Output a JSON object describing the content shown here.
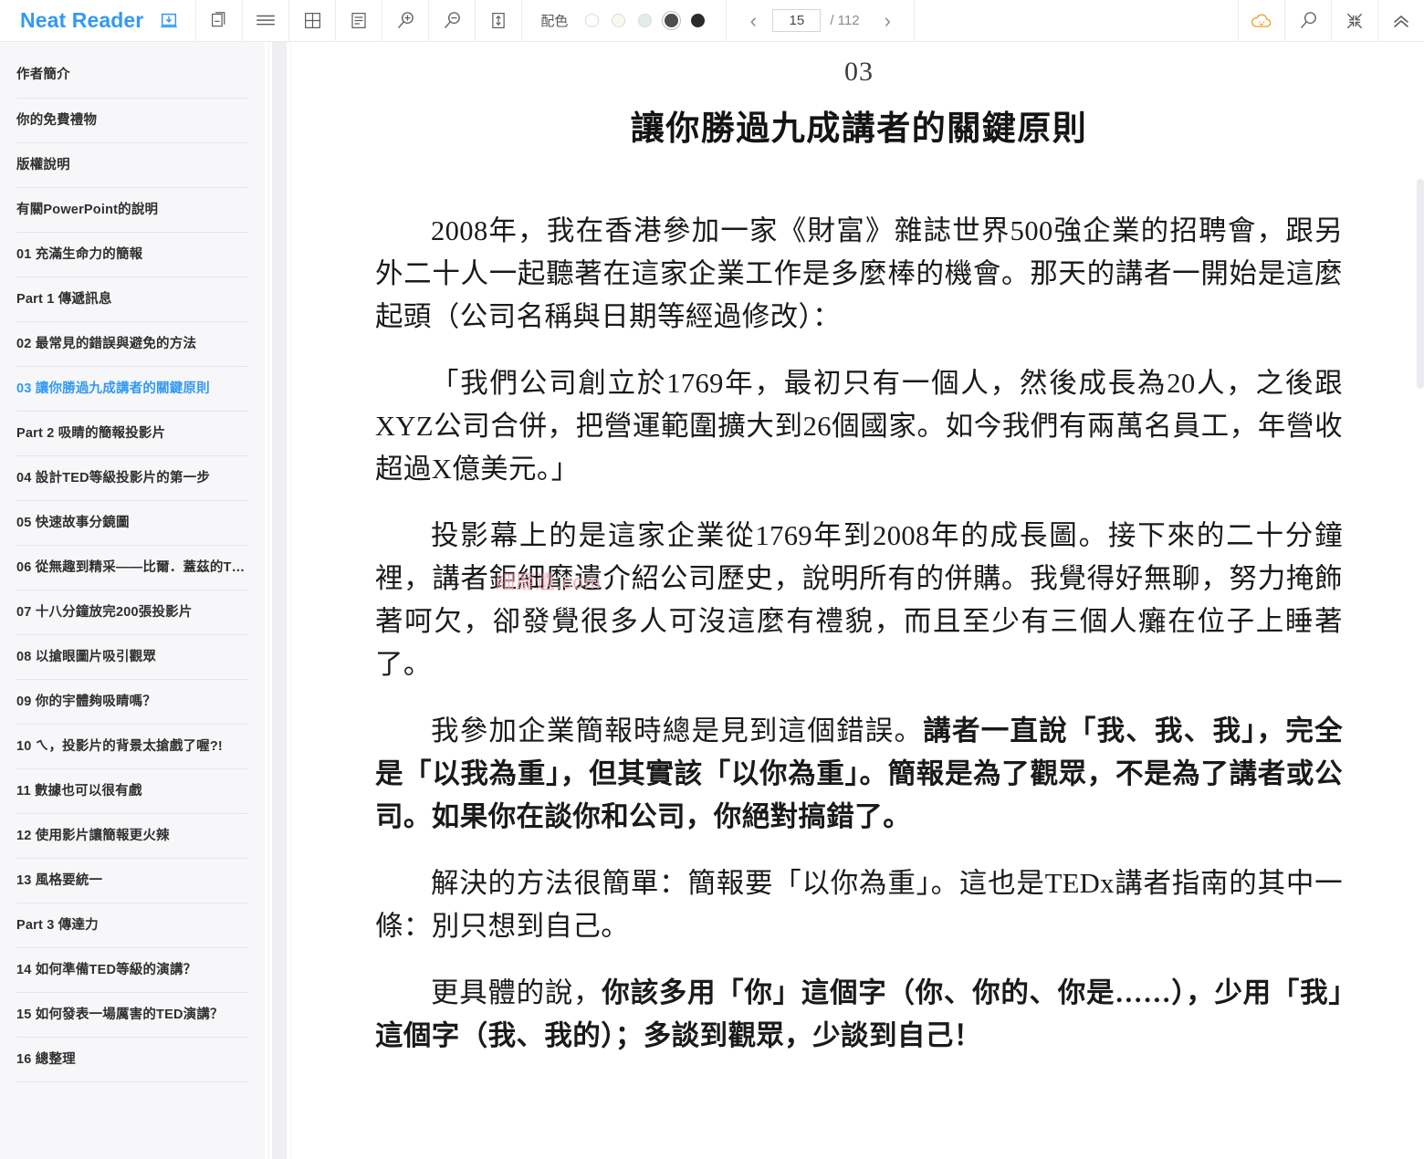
{
  "app": {
    "brand": "Neat Reader",
    "brand_color": "#3399f3"
  },
  "toolbar": {
    "icons": [
      {
        "name": "import-book-icon",
        "label": "匯入"
      },
      {
        "name": "two-page-layout-icon",
        "label": "雙頁"
      },
      {
        "name": "list-view-icon",
        "label": "列表"
      },
      {
        "name": "grid-view-icon",
        "label": "格狀"
      },
      {
        "name": "notes-icon",
        "label": "筆記"
      },
      {
        "name": "zoom-in-icon",
        "label": "放大"
      },
      {
        "name": "zoom-out-icon",
        "label": "縮小"
      },
      {
        "name": "line-height-icon",
        "label": "行距"
      }
    ],
    "palette_label": "配色",
    "swatches": [
      {
        "name": "theme-white",
        "color": "#ffffff",
        "selected": false
      },
      {
        "name": "theme-cream",
        "color": "#fbf8f1",
        "selected": false
      },
      {
        "name": "theme-green",
        "color": "#e2efe6",
        "selected": false
      },
      {
        "name": "theme-gray",
        "color": "#4d4d4d",
        "selected": true
      },
      {
        "name": "theme-black",
        "color": "#2b2b2b",
        "selected": false
      }
    ],
    "pager": {
      "prev": "‹",
      "next": "›",
      "current": "15",
      "separator": "/ 112",
      "total": "112"
    },
    "right_icons": [
      {
        "name": "cloud-sync-icon",
        "color": "#f0a028"
      },
      {
        "name": "search-icon",
        "color": "#6e6e6e"
      },
      {
        "name": "compress-icon",
        "color": "#6e6e6e"
      },
      {
        "name": "chevron-up-double-icon",
        "color": "#6e6e6e"
      }
    ]
  },
  "sidebar": {
    "items": [
      {
        "label": "作者簡介",
        "active": false
      },
      {
        "label": "你的免費禮物",
        "active": false
      },
      {
        "label": "版權說明",
        "active": false
      },
      {
        "label": "有關PowerPoint的說明",
        "active": false
      },
      {
        "label": "01 充滿生命力的簡報",
        "active": false
      },
      {
        "label": "Part 1 傳遞訊息",
        "active": false
      },
      {
        "label": "02 最常見的錯誤與避免的方法",
        "active": false
      },
      {
        "label": "03 讓你勝過九成講者的關鍵原則",
        "active": true
      },
      {
        "label": "Part 2 吸睛的簡報投影片",
        "active": false
      },
      {
        "label": "04 設計TED等級投影片的第一步",
        "active": false
      },
      {
        "label": "05 快速故事分鏡圖",
        "active": false
      },
      {
        "label": "06 從無趣到精采——比爾．蓋茲的TE…",
        "active": false
      },
      {
        "label": "07 十八分鐘放完200張投影片",
        "active": false
      },
      {
        "label": "08 以搶眼圖片吸引觀眾",
        "active": false
      },
      {
        "label": "09 你的宇體夠吸睛嗎？",
        "active": false
      },
      {
        "label": "10 ㄟ，投影片的背景太搶戲了喔?!",
        "active": false
      },
      {
        "label": "11 數據也可以很有戲",
        "active": false
      },
      {
        "label": "12 使用影片讓簡報更火辣",
        "active": false
      },
      {
        "label": "13 風格要統一",
        "active": false
      },
      {
        "label": "Part 3 傳達力",
        "active": false
      },
      {
        "label": "14 如何準備TED等級的演講？",
        "active": false
      },
      {
        "label": "15 如何發表一場厲害的TED演講？",
        "active": false
      },
      {
        "label": "16 總整理",
        "active": false
      }
    ]
  },
  "content": {
    "chapter_number": "03",
    "chapter_title": "讓你勝過九成講者的關鍵原則",
    "watermark": "細靡遺.com",
    "paragraphs": [
      {
        "id": "p1",
        "text": "2008年，我在香港參加一家《財富》雜誌世界500強企業的招聘會，跟另外二十人一起聽著在這家企業工作是多麼棒的機會。那天的講者一開始是這麼起頭（公司名稱與日期等經過修改）："
      },
      {
        "id": "p2",
        "text": "「我們公司創立於1769年，最初只有一個人，然後成長為20人，之後跟XYZ公司合併，把營運範圍擴大到26個國家。如今我們有兩萬名員工，年營收超過X億美元。」"
      },
      {
        "id": "p3",
        "text": "投影幕上的是這家企業從1769年到2008年的成長圖。接下來的二十分鐘裡，講者鉅細靡遺介紹公司歷史，說明所有的併購。我覺得好無聊，努力掩飾著呵欠，卻發覺很多人可沒這麼有禮貌，而且至少有三個人癱在位子上睡著了。"
      },
      {
        "id": "p4",
        "normal": "我參加企業簡報時總是見到這個錯誤。",
        "bold": "講者一直說「我、我、我」，完全是「以我為重」，但其實該「以你為重」。簡報是為了觀眾，不是為了講者或公司。如果你在談你和公司，你絕對搞錯了。"
      },
      {
        "id": "p5",
        "text": "解決的方法很簡單：簡報要「以你為重」。這也是TEDx講者指南的其中一條：別只想到自己。"
      },
      {
        "id": "p6",
        "normal": "更具體的說，",
        "bold": "你該多用「你」這個字（你、你的、你是……），少用「我」這個字（我、我的）；多談到觀眾，少談到自己！"
      }
    ]
  }
}
